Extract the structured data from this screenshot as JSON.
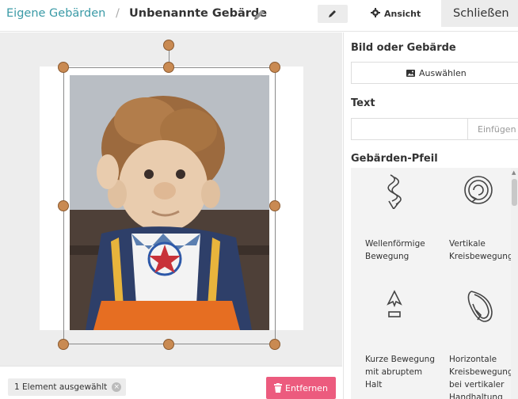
{
  "header": {
    "breadcrumb_parent": "Eigene Gebärden",
    "breadcrumb_separator": "/",
    "breadcrumb_current": "Unbenannte Gebärde",
    "view_label": "Ansicht",
    "close_label": "Schließen"
  },
  "canvas": {
    "photo_icon": "puppet-photo",
    "selection_status": "1 Element ausgewählt",
    "remove_label": "Entfernen"
  },
  "panel": {
    "image_section_title": "Bild oder Gebärde",
    "choose_label": "Auswählen",
    "text_section_title": "Text",
    "text_value": "",
    "insert_label": "Einfügen",
    "arrow_section_title": "Gebärden-Pfeil",
    "arrows": [
      {
        "label": "Wellenförmige Bewegung",
        "icon": "wave-arrow-icon"
      },
      {
        "label": "Vertikale Kreisbewegung",
        "icon": "circle-arrow-icon"
      },
      {
        "label": "Kurze Bewegung mit abruptem Halt",
        "icon": "stop-arrow-icon"
      },
      {
        "label": "Horizontale Kreisbewegung bei vertikaler Handhaltung",
        "icon": "horizontal-circle-arrow-icon"
      }
    ]
  },
  "colors": {
    "accent_teal": "#3a9aa6",
    "remove_pink": "#ec5b7e",
    "handle_brown": "#c98a52"
  }
}
